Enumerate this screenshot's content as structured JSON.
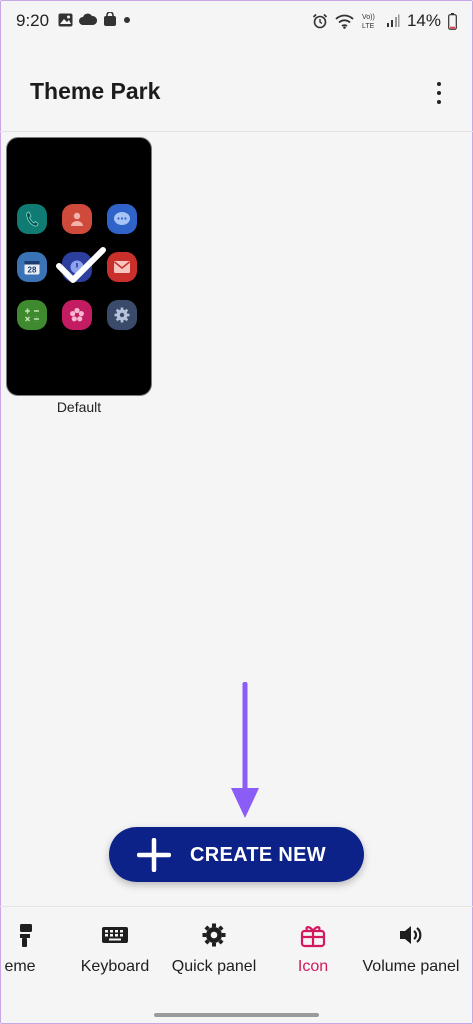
{
  "status_bar": {
    "time": "9:20",
    "battery_percent": "14%",
    "battery_fraction": 0.14,
    "icons": [
      "gallery-icon",
      "cloud-icon",
      "shopping-bag-icon",
      "dot-icon",
      "alarm-icon",
      "wifi-icon",
      "volte-icon",
      "signal-icon",
      "battery-icon"
    ],
    "volte_text_top": "Vo))",
    "volte_text_bottom": "LTE"
  },
  "app_bar": {
    "title": "Theme Park",
    "more_icon": "more-vert-icon"
  },
  "theme_card": {
    "label": "Default",
    "selected": true,
    "calendar_date": "28",
    "colors": {
      "phone": "#0f7b72",
      "contacts": "#d04a3b",
      "messages": "#2f63c9",
      "calendar": "#3a73b6",
      "clock": "#2d3f9e",
      "email": "#c9302b",
      "calculator": "#3f8a2e",
      "gallery": "#c41c62",
      "settings": "#3a4a6b"
    }
  },
  "create_button": {
    "label": "CREATE NEW",
    "color": "#0d2289"
  },
  "annotation_arrow_color": "#8b5cf6",
  "bottom_nav": {
    "items": [
      {
        "label": "eme",
        "icon": "brush-icon",
        "active": false
      },
      {
        "label": "Keyboard",
        "icon": "keyboard-icon",
        "active": false
      },
      {
        "label": "Quick panel",
        "icon": "gear-icon",
        "active": false
      },
      {
        "label": "Icon",
        "icon": "icon-pack-icon",
        "active": true
      },
      {
        "label": "Volume panel",
        "icon": "volume-icon",
        "active": false
      }
    ],
    "active_color": "#d3185f"
  }
}
